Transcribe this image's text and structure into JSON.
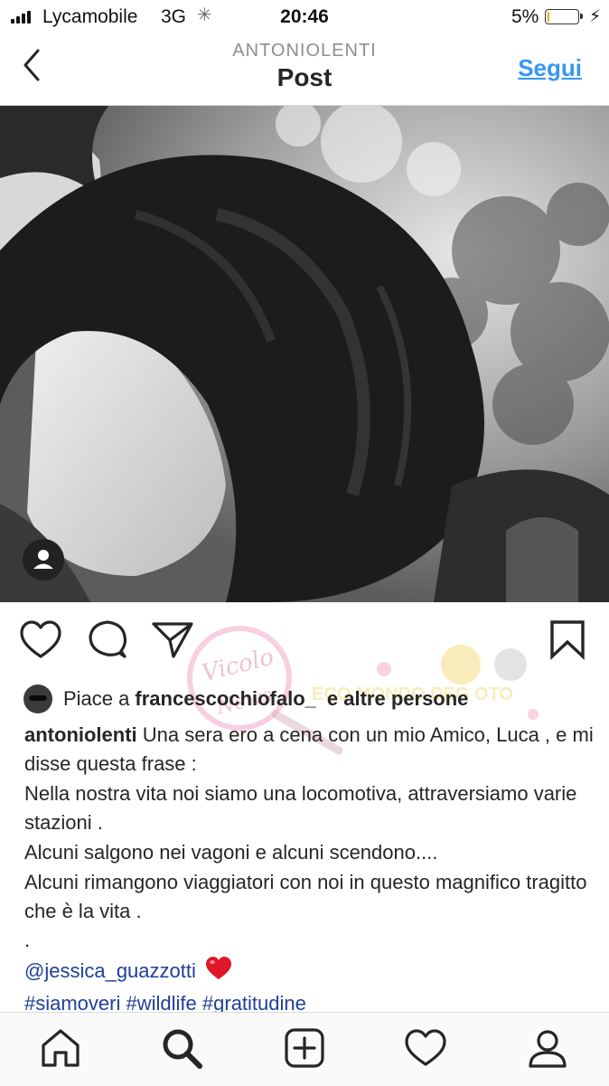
{
  "status_bar": {
    "carrier": "Lycamobile",
    "network": "3G",
    "time": "20:46",
    "battery_percent": "5%",
    "battery_level": 0.05
  },
  "header": {
    "username": "ANTONIOLENTI",
    "title": "Post",
    "follow_label": "Segui"
  },
  "post": {
    "photo_icon": "person-tag-icon",
    "likes": {
      "prefix": "Piace a",
      "user": "francescochiofalo_",
      "suffix": "e altre persone"
    },
    "caption": {
      "username": "antoniolenti",
      "first_line": "Una sera ero a cena con un mio Amico, Luca ,  e mi disse questa frase :",
      "lines": [
        "Nella nostra vita noi siamo una locomotiva, attraversiamo varie stazioni .",
        "Alcuni salgono nei vagoni e alcuni scendono....",
        "Alcuni rimangono viaggiatori con noi in questo magnifico tragitto che è la vita .",
        "."
      ],
      "mention": "@jessica_guazzotti",
      "emoji": "❤️",
      "hashtags": [
        "#siamoveri",
        "#wildlife",
        "#gratitudine"
      ]
    }
  },
  "watermark": {
    "text": "Vicolo delle News"
  },
  "icons": {
    "actions": [
      "heart-icon",
      "comment-icon",
      "share-icon",
      "bookmark-icon"
    ],
    "tabs": [
      "home-icon",
      "search-icon",
      "add-icon",
      "activity-icon",
      "profile-icon"
    ]
  },
  "colors": {
    "link": "#3897f0",
    "hashtag": "#1e3f9a",
    "heart": "#e0162b"
  }
}
